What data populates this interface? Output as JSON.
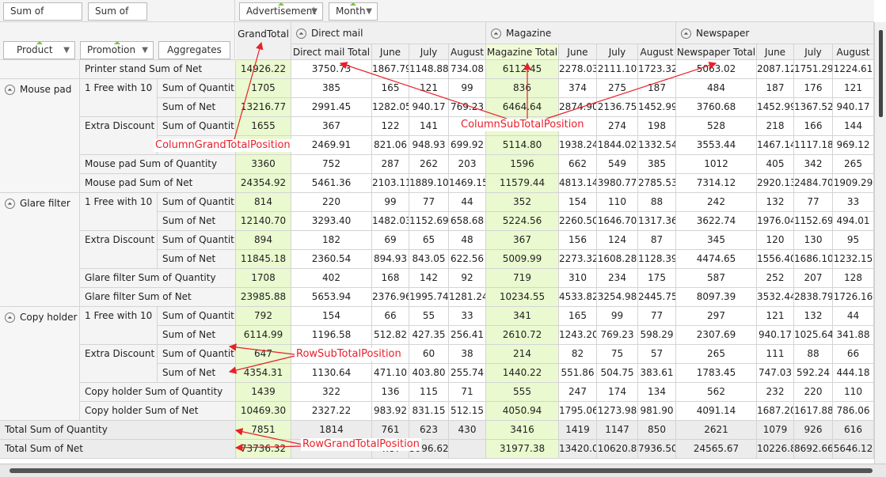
{
  "filters": [
    "Sum of Quantity",
    "Sum of Net"
  ],
  "column_fields": [
    "Advertisement",
    "Month"
  ],
  "row_fields": [
    "Product",
    "Promotion",
    "Aggregates"
  ],
  "top_headers": {
    "grand": "GrandTotal",
    "dm": "Direct mail",
    "mag": "Magazine",
    "np": "Newspaper"
  },
  "sub_headers": [
    "Direct mail Total",
    "June",
    "July",
    "August",
    "Magazine Total",
    "June",
    "July",
    "August",
    "Newspaper Total",
    "June",
    "July",
    "August"
  ],
  "products": [
    "Mouse pad",
    "Glare filter",
    "Copy holder"
  ],
  "rows": [
    {
      "p": "",
      "pr": "Printer stand Sum of Net",
      "ag": "",
      "v": [
        "14926.22",
        "3750.73",
        "1867.79",
        "1148.88",
        "734.08",
        "6112.45",
        "2278.03",
        "2111.10",
        "1723.32",
        "5063.02",
        "2087.12",
        "1751.29",
        "1224.61"
      ]
    },
    {
      "p": "",
      "pr": "1 Free with 10",
      "ag": "Sum of Quantit",
      "v": [
        "1705",
        "385",
        "165",
        "121",
        "99",
        "836",
        "374",
        "275",
        "187",
        "484",
        "187",
        "176",
        "121"
      ]
    },
    {
      "p": "",
      "pr": "",
      "ag": "Sum of Net",
      "v": [
        "13216.77",
        "2991.45",
        "1282.05",
        "940.17",
        "769.23",
        "6464.64",
        "2874.90",
        "2136.75",
        "1452.99",
        "3760.68",
        "1452.99",
        "1367.52",
        "940.17"
      ]
    },
    {
      "p": "",
      "pr": "Extra Discount",
      "ag": "Sum of Quantit",
      "v": [
        "1655",
        "367",
        "122",
        "141",
        "",
        "",
        "",
        "274",
        "198",
        "528",
        "218",
        "166",
        "144"
      ]
    },
    {
      "p": "",
      "pr": "",
      "ag": "",
      "v": [
        "",
        "2469.91",
        "821.06",
        "948.93",
        "699.92",
        "5114.80",
        "1938.24",
        "1844.02",
        "1332.54",
        "3553.44",
        "1467.14",
        "1117.18",
        "969.12"
      ]
    },
    {
      "p": "",
      "pr": "Mouse pad Sum of Quantity",
      "ag": "",
      "v": [
        "3360",
        "752",
        "287",
        "262",
        "203",
        "1596",
        "662",
        "549",
        "385",
        "1012",
        "405",
        "342",
        "265"
      ]
    },
    {
      "p": "",
      "pr": "Mouse pad Sum of Net",
      "ag": "",
      "v": [
        "24354.92",
        "5461.36",
        "2103.11",
        "1889.10",
        "1469.15",
        "11579.44",
        "4813.14",
        "3980.77",
        "2785.53",
        "7314.12",
        "2920.13",
        "2484.70",
        "1909.29"
      ]
    },
    {
      "p": "",
      "pr": "1 Free with 10",
      "ag": "Sum of Quantit",
      "v": [
        "814",
        "220",
        "99",
        "77",
        "44",
        "352",
        "154",
        "110",
        "88",
        "242",
        "132",
        "77",
        "33"
      ]
    },
    {
      "p": "",
      "pr": "",
      "ag": "Sum of Net",
      "v": [
        "12140.70",
        "3293.40",
        "1482.03",
        "1152.69",
        "658.68",
        "5224.56",
        "2260.50",
        "1646.70",
        "1317.36",
        "3622.74",
        "1976.04",
        "1152.69",
        "494.01"
      ]
    },
    {
      "p": "",
      "pr": "Extra Discount",
      "ag": "Sum of Quantit",
      "v": [
        "894",
        "182",
        "69",
        "65",
        "48",
        "367",
        "156",
        "124",
        "87",
        "345",
        "120",
        "130",
        "95"
      ]
    },
    {
      "p": "",
      "pr": "",
      "ag": "Sum of Net",
      "v": [
        "11845.18",
        "2360.54",
        "894.93",
        "843.05",
        "622.56",
        "5009.99",
        "2273.32",
        "1608.28",
        "1128.39",
        "4474.65",
        "1556.40",
        "1686.10",
        "1232.15"
      ]
    },
    {
      "p": "",
      "pr": "Glare filter Sum of Quantity",
      "ag": "",
      "v": [
        "1708",
        "402",
        "168",
        "142",
        "92",
        "719",
        "310",
        "234",
        "175",
        "587",
        "252",
        "207",
        "128"
      ]
    },
    {
      "p": "",
      "pr": "Glare filter Sum of Net",
      "ag": "",
      "v": [
        "23985.88",
        "5653.94",
        "2376.96",
        "1995.74",
        "1281.24",
        "10234.55",
        "4533.82",
        "3254.98",
        "2445.75",
        "8097.39",
        "3532.44",
        "2838.79",
        "1726.16"
      ]
    },
    {
      "p": "",
      "pr": "1 Free with 10",
      "ag": "Sum of Quantit",
      "v": [
        "792",
        "154",
        "66",
        "55",
        "33",
        "341",
        "165",
        "99",
        "77",
        "297",
        "121",
        "132",
        "44"
      ]
    },
    {
      "p": "",
      "pr": "",
      "ag": "Sum of Net",
      "v": [
        "6114.99",
        "1196.58",
        "512.82",
        "427.35",
        "256.41",
        "2610.72",
        "1243.20",
        "769.23",
        "598.29",
        "2307.69",
        "940.17",
        "1025.64",
        "341.88"
      ]
    },
    {
      "p": "",
      "pr": "Extra Discount",
      "ag": "Sum of Quantit",
      "v": [
        "647",
        "",
        "",
        "60",
        "38",
        "214",
        "82",
        "75",
        "57",
        "265",
        "111",
        "88",
        "66"
      ]
    },
    {
      "p": "",
      "pr": "",
      "ag": "Sum of Net",
      "v": [
        "4354.31",
        "1130.64",
        "471.10",
        "403.80",
        "255.74",
        "1440.22",
        "551.86",
        "504.75",
        "383.61",
        "1783.45",
        "747.03",
        "592.24",
        "444.18"
      ]
    },
    {
      "p": "",
      "pr": "Copy holder Sum of Quantity",
      "ag": "",
      "v": [
        "1439",
        "322",
        "136",
        "115",
        "71",
        "555",
        "247",
        "174",
        "134",
        "562",
        "232",
        "220",
        "110"
      ]
    },
    {
      "p": "",
      "pr": "Copy holder Sum of Net",
      "ag": "",
      "v": [
        "10469.30",
        "2327.22",
        "983.92",
        "831.15",
        "512.15",
        "4050.94",
        "1795.06",
        "1273.98",
        "981.90",
        "4091.14",
        "1687.20",
        "1617.88",
        "786.06"
      ]
    },
    {
      "p": "Total Sum of Quantity",
      "pr": "",
      "ag": "",
      "v": [
        "7851",
        "1814",
        "761",
        "623",
        "430",
        "3416",
        "1419",
        "1147",
        "850",
        "2621",
        "1079",
        "926",
        "616"
      ]
    },
    {
      "p": "Total Sum of Net",
      "pr": "",
      "ag": "",
      "v": [
        "73736.32",
        "",
        "4.87",
        "3996.62",
        "",
        "31977.38",
        "13420.0",
        "10620.8",
        "7936.50",
        "24565.67",
        "10226.8",
        "8692.66",
        "5646.12"
      ]
    }
  ],
  "annotations": {
    "col_grand": "ColumnGrandTotalPosition",
    "col_sub": "ColumnSubTotalPosition",
    "row_sub": "RowSubTotalPosition",
    "row_grand": "RowGrandTotalPosition"
  }
}
